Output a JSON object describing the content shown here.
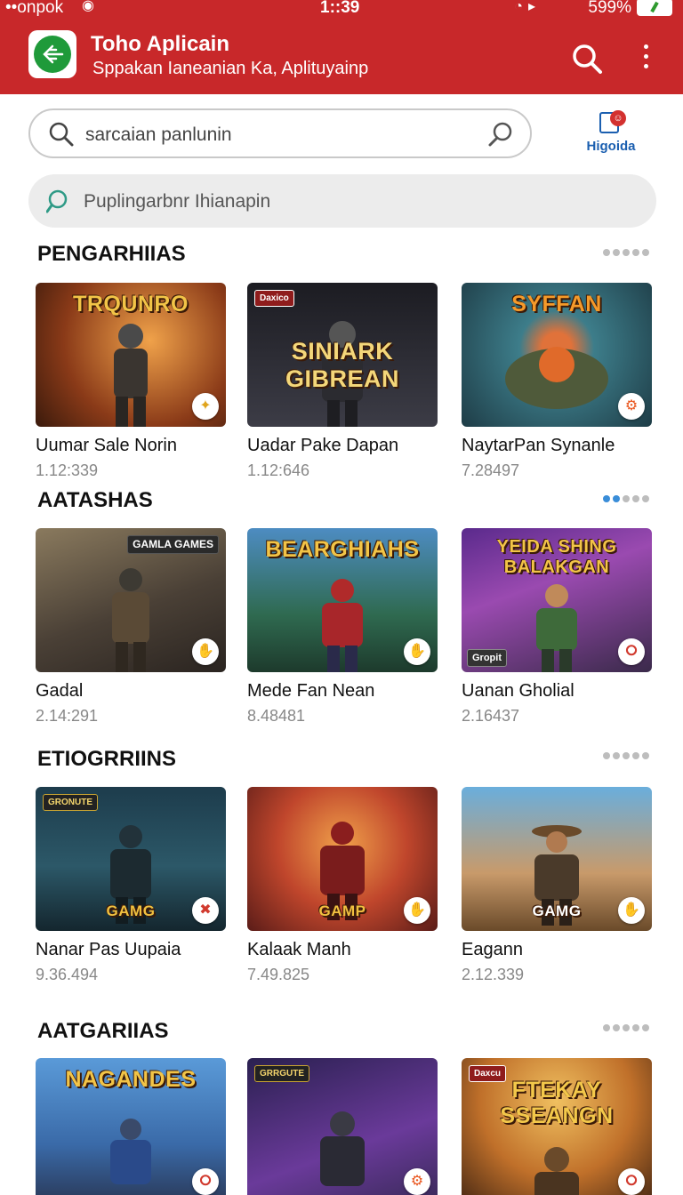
{
  "status": {
    "carrier": "••onpok",
    "time": "1::39",
    "battery": "599%"
  },
  "header": {
    "title": "Toho Aplicain",
    "subtitle": "Sppakan Ianeanian Ka, Aplituyainp"
  },
  "search": {
    "placeholder": "sarcaian panlunin"
  },
  "shortcut": {
    "label": "Higoida"
  },
  "secondary_search": {
    "placeholder": "Puplingarbnr Ihianapin"
  },
  "sections": [
    {
      "title": "PENGARHIIAS",
      "cards": [
        {
          "name": "Uumar Sale Norin",
          "meta": "1.12:339",
          "overlay": "TRQUNRO",
          "accent": "#c86a2a"
        },
        {
          "name": "Uadar Pake Dapan",
          "meta": "1.12:646",
          "overlay": "SINIARK GIBREAN",
          "tag": "Daxico",
          "accent": "#2c2c36"
        },
        {
          "name": "NaytarPan Synanle",
          "meta": "7.28497",
          "overlay": "SYFFAN",
          "accent": "#3d7d8a"
        }
      ]
    },
    {
      "title": "AATASHAS",
      "cards": [
        {
          "name": "Gadal",
          "meta": "2.14:291",
          "tag": "GAMLA GAMES",
          "accent": "#5a5046"
        },
        {
          "name": "Mede Fan Nean",
          "meta": "8.48481",
          "overlay": "BEARGHIAHS",
          "accent": "#3a6fa0"
        },
        {
          "name": "Uanan Gholial",
          "meta": "2.16437",
          "overlay": "YEIDA SHING BALAKGAN",
          "tag": "Gropit",
          "accent": "#6a3d8c"
        }
      ]
    },
    {
      "title": "ETIOGRRIINS",
      "cards": [
        {
          "name": "Nanar Pas Uupaia",
          "meta": "9.36.494",
          "overlay": "GAMG",
          "tag": "GRONUTE",
          "accent": "#1f4a5c"
        },
        {
          "name": "Kalaak Manh",
          "meta": "7.49.825",
          "overlay": "GAMP",
          "accent": "#b0412c"
        },
        {
          "name": "Eagann",
          "meta": "2.12.339",
          "overlay": "GAMG",
          "accent": "#4e86b3"
        }
      ]
    },
    {
      "title": "AATGARIIAS",
      "cards": [
        {
          "name": "",
          "meta": "",
          "overlay": "NAGANDES",
          "tag": "",
          "accent": "#3571b8"
        },
        {
          "name": "",
          "meta": "",
          "tag": "GRRGUTE",
          "accent": "#3c2f6a"
        },
        {
          "name": "",
          "meta": "",
          "overlay": "FTEKAY SSEANGN",
          "tag": "Daxcu",
          "accent": "#b8642a"
        }
      ]
    }
  ],
  "icons": {
    "app_logo": "back-arrow-icon",
    "header_search": "search-icon",
    "menu": "more-vert-icon",
    "shortcut": "notification-icon",
    "card_badges": [
      "crest-icon",
      "gear-icon",
      "hand-icon",
      "pin-icon"
    ]
  },
  "colors": {
    "header_bg": "#c8282a",
    "accent_blue": "#1b5fb0",
    "logo_green": "#1f9a3a"
  }
}
